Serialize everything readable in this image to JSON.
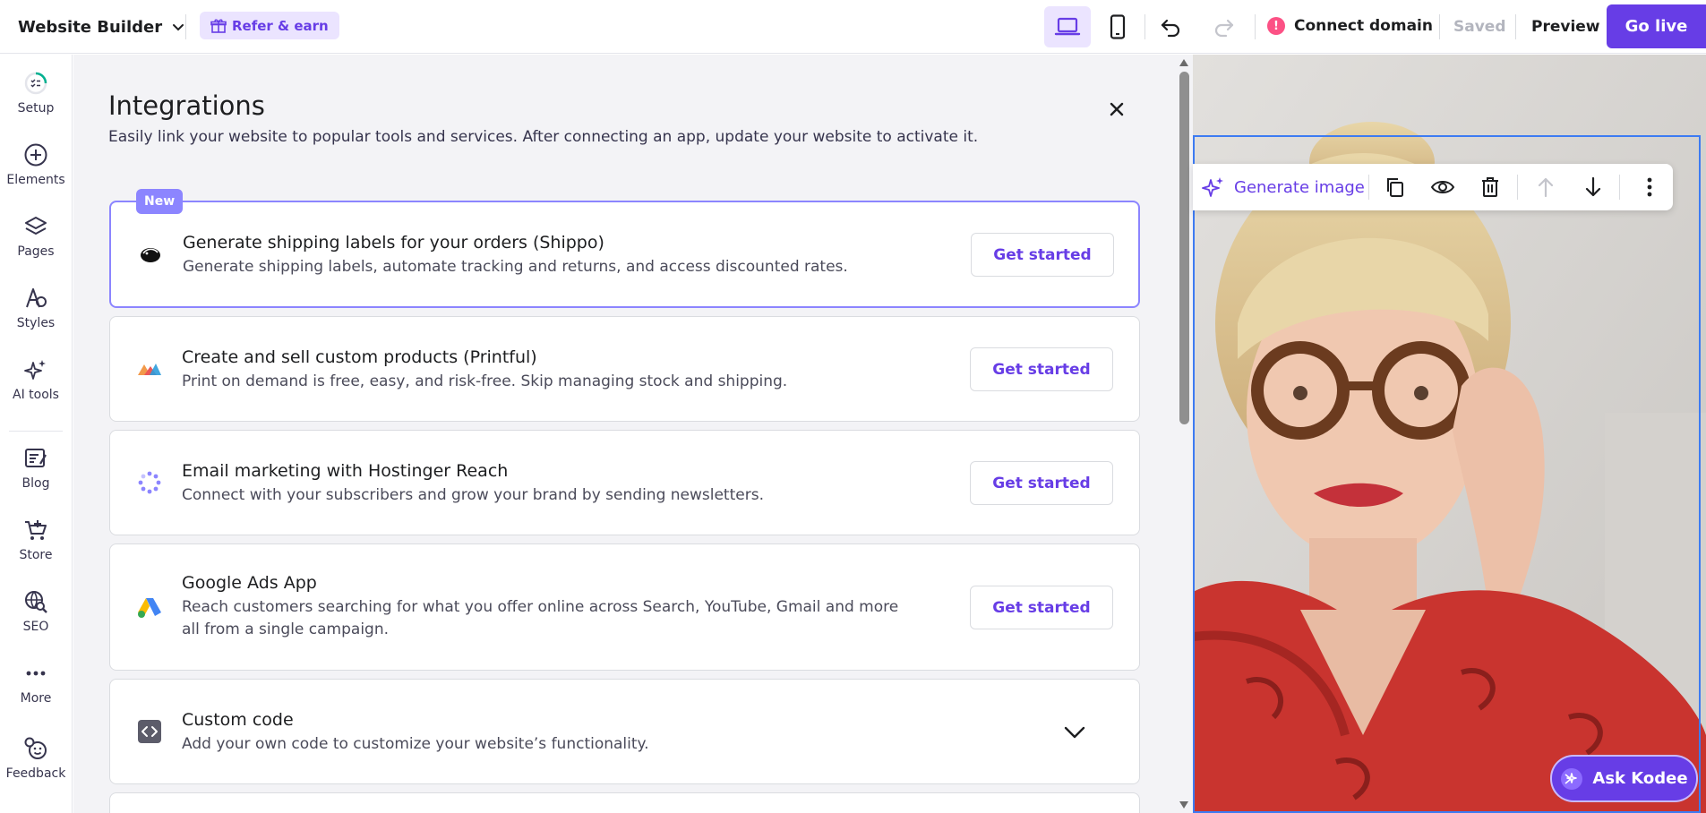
{
  "topbar": {
    "brand": "Website Builder",
    "refer": "Refer & earn",
    "connect_domain": "Connect domain",
    "alert": "!",
    "saved": "Saved",
    "preview": "Preview",
    "go_live": "Go live"
  },
  "sidebar": {
    "items": [
      {
        "label": "Setup",
        "icon": "setup-progress-icon"
      },
      {
        "label": "Elements",
        "icon": "plus-circle-icon"
      },
      {
        "label": "Pages",
        "icon": "layers-icon"
      },
      {
        "label": "Styles",
        "icon": "styles-icon"
      },
      {
        "label": "AI tools",
        "icon": "sparkles-icon"
      },
      {
        "label": "Blog",
        "icon": "blog-icon"
      },
      {
        "label": "Store",
        "icon": "cart-icon"
      },
      {
        "label": "SEO",
        "icon": "seo-icon"
      },
      {
        "label": "More",
        "icon": "more-horizontal-icon"
      },
      {
        "label": "Feedback",
        "icon": "feedback-icon"
      }
    ]
  },
  "integrations": {
    "title": "Integrations",
    "subtitle": "Easily link your website to popular tools and services. After connecting an app, update your website to activate it.",
    "new_badge": "New",
    "cards": [
      {
        "title": "Generate shipping labels for your orders (Shippo)",
        "desc": "Generate shipping labels, automate tracking and returns, and access discounted rates.",
        "button": "Get started",
        "icon": "shippo-icon"
      },
      {
        "title": "Create and sell custom products (Printful)",
        "desc": "Print on demand is free, easy, and risk-free. Skip managing stock and shipping.",
        "button": "Get started",
        "icon": "printful-icon"
      },
      {
        "title": "Email marketing with Hostinger Reach",
        "desc": "Connect with your subscribers and grow your brand by sending newsletters.",
        "button": "Get started",
        "icon": "reach-icon"
      },
      {
        "title": "Google Ads App",
        "desc": "Reach customers searching for what you offer online across Search, YouTube, Gmail and more all from a single campaign.",
        "button": "Get started",
        "icon": "google-ads-icon"
      },
      {
        "title": "Custom code",
        "desc": "Add your own code to customize your website’s functionality.",
        "icon": "code-icon"
      }
    ]
  },
  "canvas_toolbar": {
    "generate_image": "Generate image"
  },
  "ask_kodee": "Ask Kodee",
  "colors": {
    "accent": "#673de6",
    "accent_light": "#ebe4ff",
    "new_badge": "#8c85ff",
    "alert": "#fc5185",
    "selection": "#3d7bf2"
  }
}
